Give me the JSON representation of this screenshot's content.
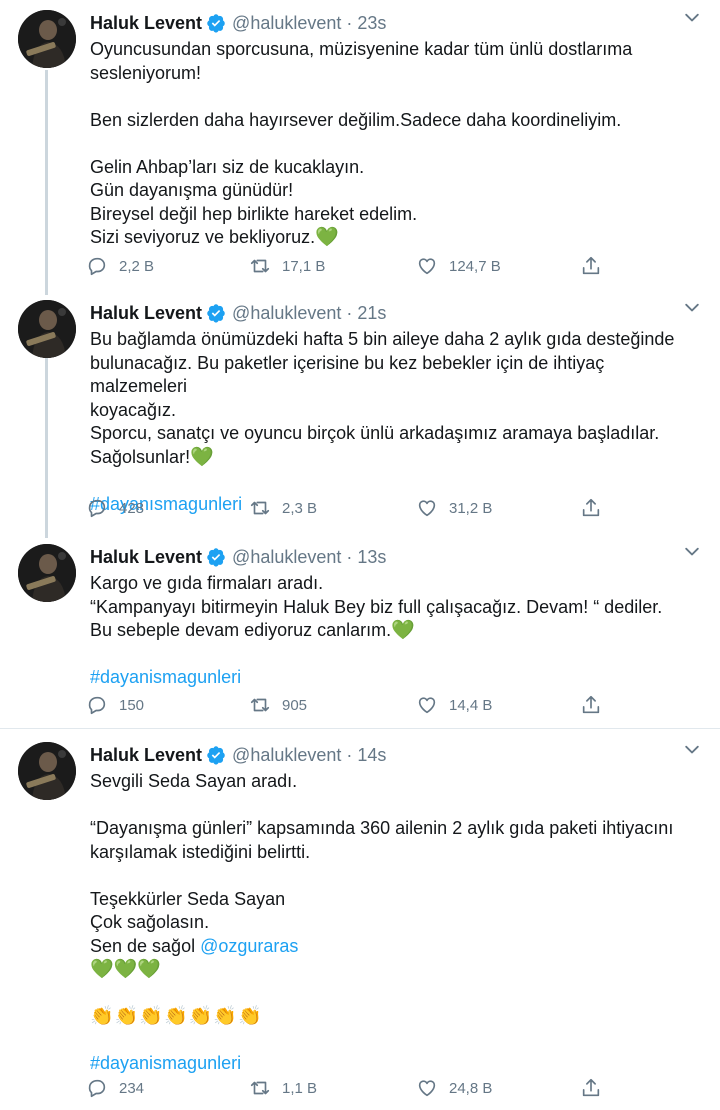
{
  "author": {
    "name": "Haluk Levent",
    "handle": "@haluklevent",
    "separator": "·"
  },
  "icons": {
    "verified": "verified-badge-icon",
    "more": "chevron-down-icon",
    "reply": "reply-icon",
    "retweet": "retweet-icon",
    "like": "heart-icon",
    "share": "share-icon"
  },
  "colors": {
    "accent": "#1da1f2",
    "green_heart": "#4fa72e",
    "muted": "#657786",
    "divider": "#e1e8ed"
  },
  "tweets": [
    {
      "time": "23s",
      "lines": [
        "Oyuncusundan sporcusuna, müzisyenine kadar tüm ünlü dostlarıma",
        "sesleniyorum!",
        "Ben sizlerden daha hayırsever değilim.Sadece daha koordineliyim.",
        "Gelin Ahbap’ları siz de kucaklayın.",
        "Gün dayanışma günüdür!",
        "Bireysel değil hep birlikte hareket edelim.",
        "Sizi seviyoruz ve bekliyoruz."
      ],
      "emoji": "💚",
      "replies": "2,2 B",
      "retweets": "17,1 B",
      "likes": "124,7 B"
    },
    {
      "time": "21s",
      "lines": [
        "Bu bağlamda önümüzdeki hafta 5 bin aileye daha 2 aylık gıda desteğinde",
        "bulunacağız. Bu paketler içerisine bu kez bebekler için de ihtiyaç malzemeleri",
        "koyacağız.",
        "Sporcu, sanatçı ve oyuncu birçok ünlü arkadaşımız aramaya başladılar.",
        "Sağolsunlar!"
      ],
      "emoji": "💚",
      "hashtag": "#dayanısmagunleri",
      "replies": "428",
      "retweets": "2,3 B",
      "likes": "31,2 B"
    },
    {
      "time": "13s",
      "lines": [
        "Kargo ve gıda firmaları aradı.",
        "“Kampanyayı bitirmeyin Haluk Bey biz full çalışacağız. Devam! “ dediler.",
        "Bu sebeple devam ediyoruz canlarım."
      ],
      "emoji": "💚",
      "hashtag": "#dayanismagunleri",
      "replies": "150",
      "retweets": "905",
      "likes": "14,4 B"
    },
    {
      "time": "14s",
      "lines": [
        "Sevgili Seda Sayan aradı.",
        "“Dayanışma günleri” kapsamında 360 ailenin 2 aylık gıda paketi ihtiyacını",
        "karşılamak istediğini belirtti.",
        "Teşekkürler Seda Sayan",
        "Çok sağolasın.",
        "Sen de sağol"
      ],
      "mention": "@ozguraras",
      "hearts": "💚💚💚",
      "claps": "👏👏👏👏👏👏👏",
      "hashtag": "#dayanismagunleri",
      "replies": "234",
      "retweets": "1,1 B",
      "likes": "24,8 B"
    }
  ]
}
